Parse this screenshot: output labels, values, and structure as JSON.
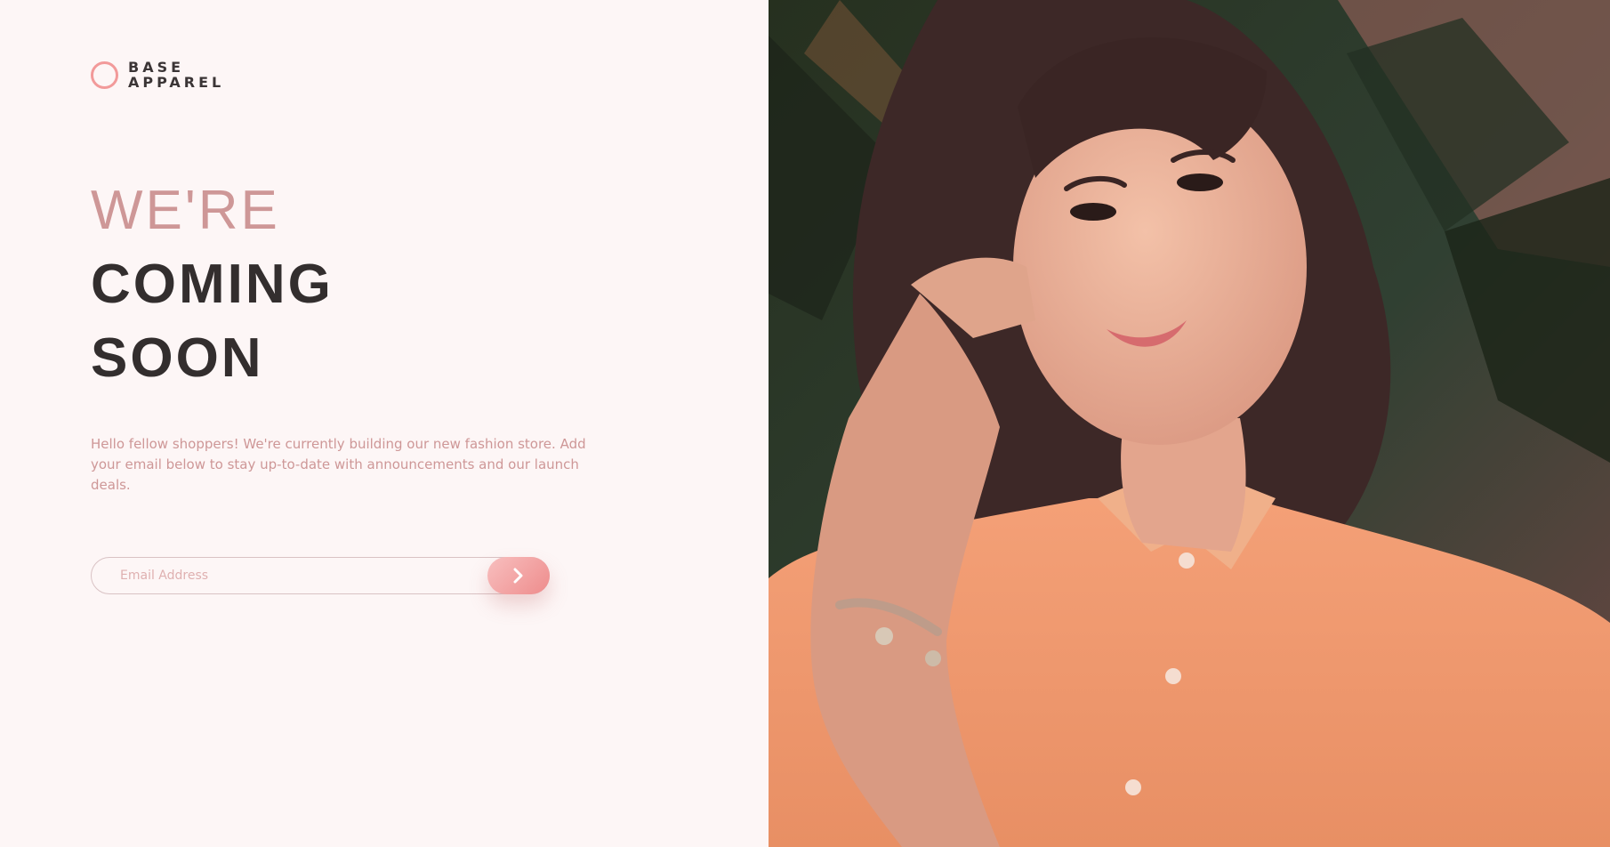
{
  "logo": {
    "line1": "BASE",
    "line2": "APPAREL"
  },
  "headline": {
    "line1": "WE'RE",
    "line2": "COMING",
    "line3": "SOON"
  },
  "intro": "Hello fellow shoppers! We're currently building our new fashion store. Add your email below to stay up-to-date with announcements and our launch deals.",
  "form": {
    "email_placeholder": "Email Address",
    "submit_icon": "chevron-right-icon"
  },
  "hero_image": "woman-in-peach-shirt-photo",
  "colors": {
    "background": "#fdf6f6",
    "accent_pink": "#ce9797",
    "dark_text": "#332e2e",
    "button_gradient_start": "#f8bfbf",
    "button_gradient_end": "#ee8c8c"
  }
}
